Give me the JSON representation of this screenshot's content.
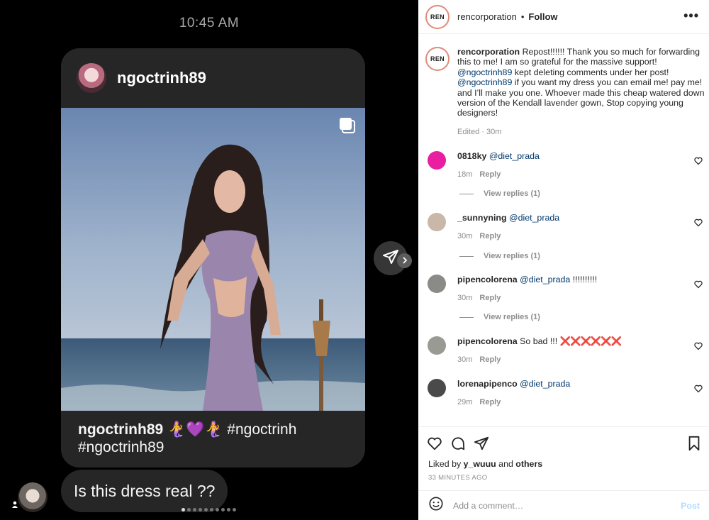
{
  "dm": {
    "time": "10:45 AM",
    "shared_post": {
      "username": "ngoctrinh89",
      "caption_user": "ngoctrinh89",
      "caption_rest": " 🧜‍♀️💜🧜‍♀️ #ngoctrinh #ngoctrinh89"
    },
    "message": "Is this dress real ??",
    "icons": {
      "multi": "multiple-images-icon",
      "share": "paper-plane-icon",
      "next": "chevron-right-icon"
    }
  },
  "post": {
    "username": "rencorporation",
    "avatar_text": "REN",
    "follow": "Follow",
    "more": "•••",
    "caption": {
      "user": "rencorporation",
      "part1": " Repost!!!!!! Thank you so much for forwarding this to me! I am so grateful for the massive support! ",
      "mention1": "@ngoctrinh89",
      "part2": " kept deleting comments under her post! ",
      "mention2": "@ngoctrinh89",
      "part3": " if you want my dress you can email me! pay me! and I’ll make you one. Whoever made this cheap watered down version of the Kendall lavender gown, Stop copying young designers!"
    },
    "caption_meta": "Edited · 30m",
    "comments": [
      {
        "user": "0818ky",
        "mention": "@diet_prada",
        "text": "",
        "time": "18m",
        "reply": "Reply",
        "replies": "View replies (1)",
        "avatar_color": "#e91ea0"
      },
      {
        "user": "_sunnyning",
        "mention": "@diet_prada",
        "text": "",
        "time": "30m",
        "reply": "Reply",
        "replies": "View replies (1)",
        "avatar_color": "#c9b7a8"
      },
      {
        "user": "pipencolorena",
        "mention": "@diet_prada",
        "text": " !!!!!!!!!!",
        "time": "30m",
        "reply": "Reply",
        "replies": "View replies (1)",
        "avatar_color": "#8a8a86"
      },
      {
        "user": "pipencolorena",
        "mention": "",
        "text": " So bad !!! ",
        "marks": "❌❌❌❌❌❌",
        "time": "30m",
        "reply": "Reply",
        "replies": "",
        "avatar_color": "#9a9a94"
      },
      {
        "user": "lorenapipenco",
        "mention": "@diet_prada",
        "text": "",
        "time": "29m",
        "reply": "Reply",
        "replies": "",
        "avatar_color": "#4a4a4a"
      }
    ],
    "liked_prefix": "Liked by ",
    "liked_user": "y_wuuu",
    "liked_mid": " and ",
    "liked_others": "others",
    "ago": "33 MINUTES AGO",
    "add_comment_placeholder": "Add a comment…",
    "post_button": "Post"
  }
}
